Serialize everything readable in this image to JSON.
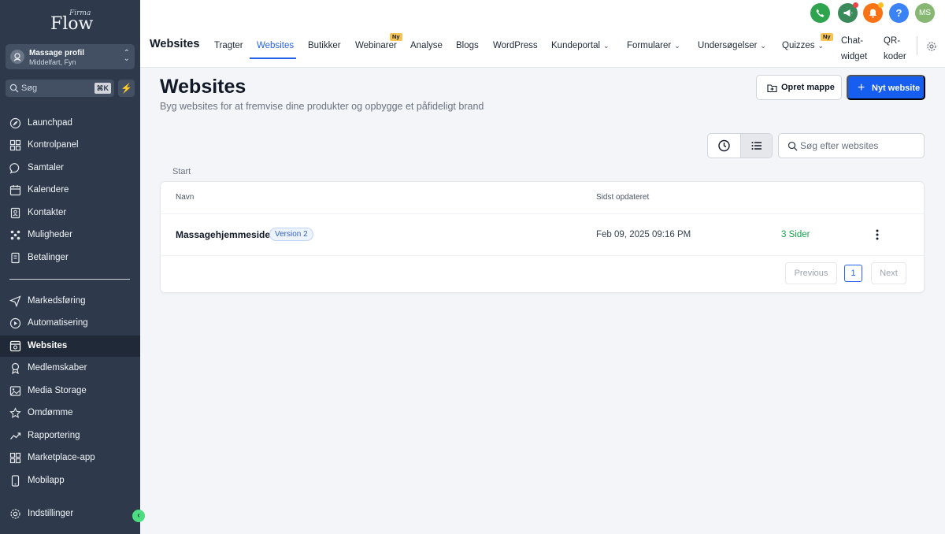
{
  "brand": {
    "firma": "Firma",
    "flow": "Flow"
  },
  "account": {
    "name": "Massage profil",
    "location": "Middelfart, Fyn"
  },
  "sidebar_search": {
    "placeholder": "Søg",
    "shortcut": "⌘K"
  },
  "sidebar": {
    "items": [
      {
        "label": "Launchpad",
        "icon": "rocket-icon"
      },
      {
        "label": "Kontrolpanel",
        "icon": "dashboard-icon"
      },
      {
        "label": "Samtaler",
        "icon": "chat-icon"
      },
      {
        "label": "Kalendere",
        "icon": "calendar-icon"
      },
      {
        "label": "Kontakter",
        "icon": "contacts-icon"
      },
      {
        "label": "Muligheder",
        "icon": "opportunities-icon"
      },
      {
        "label": "Betalinger",
        "icon": "payments-icon"
      },
      {
        "label": "Markedsføring",
        "icon": "send-icon"
      },
      {
        "label": "Automatisering",
        "icon": "automation-icon"
      },
      {
        "label": "Websites",
        "icon": "website-icon"
      },
      {
        "label": "Medlemskaber",
        "icon": "membership-icon"
      },
      {
        "label": "Media Storage",
        "icon": "image-icon"
      },
      {
        "label": "Omdømme",
        "icon": "star-icon"
      },
      {
        "label": "Rapportering",
        "icon": "chart-icon"
      },
      {
        "label": "Marketplace-app",
        "icon": "apps-icon"
      },
      {
        "label": "Mobilapp",
        "icon": "mobile-icon"
      },
      {
        "label": "Indstillinger",
        "icon": "gear-icon"
      }
    ],
    "active": "Websites"
  },
  "topbar": {
    "title": "Websites",
    "tabs": [
      {
        "label": "Tragter"
      },
      {
        "label": "Websites"
      },
      {
        "label": "Butikker"
      },
      {
        "label": "Webinarer"
      },
      {
        "label": "Analyse"
      },
      {
        "label": "Blogs"
      },
      {
        "label": "WordPress"
      },
      {
        "label": "Kundeportal"
      },
      {
        "label": "Formularer"
      },
      {
        "label": "Undersøgelser"
      },
      {
        "label": "Quizzes"
      },
      {
        "label": "Chat-"
      },
      {
        "label": "widget"
      },
      {
        "label": "QR-"
      },
      {
        "label": "koder"
      }
    ],
    "new_badge": "Ny",
    "avatar_initials": "MS",
    "help": "?"
  },
  "page": {
    "title": "Websites",
    "subtitle": "Byg websites for at fremvise dine produkter og opbygge et påfideligt brand",
    "create_folder_label": "Opret mappe",
    "new_website_label": "Nyt website",
    "search_placeholder": "Søg efter websites",
    "breadcrumb": "Start"
  },
  "table": {
    "columns": [
      "Navn",
      "Sidst opdateret"
    ],
    "rows": [
      {
        "name": "Massagehjemmeside",
        "version": "Version 2",
        "updated": "Feb 09, 2025 09:16 PM",
        "pages": "3 Sider"
      }
    ],
    "pagination": {
      "previous": "Previous",
      "page": "1",
      "next": "Next"
    }
  },
  "colors": {
    "sidebar_bg": "#2e3a4b",
    "accent": "#155eef",
    "phone": "#2ea44f",
    "megaphone": "#3a8a5a",
    "bell": "#f97316",
    "help": "#3b82f6",
    "avatar": "#86b874"
  }
}
